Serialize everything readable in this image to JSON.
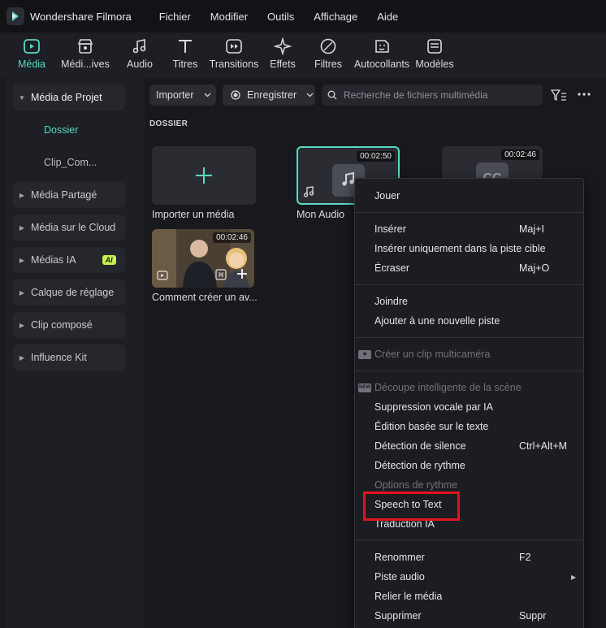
{
  "app": {
    "name": "Wondershare Filmora"
  },
  "menu": [
    "Fichier",
    "Modifier",
    "Outils",
    "Affichage",
    "Aide"
  ],
  "tabs": [
    {
      "label": "Média",
      "icon": "media-icon",
      "active": true
    },
    {
      "label": "Médi...ives",
      "icon": "store-icon",
      "active": false
    },
    {
      "label": "Audio",
      "icon": "music-note-icon",
      "active": false
    },
    {
      "label": "Titres",
      "icon": "text-icon",
      "active": false
    },
    {
      "label": "Transitions",
      "icon": "transition-icon",
      "active": false
    },
    {
      "label": "Effets",
      "icon": "sparkle-icon",
      "active": false
    },
    {
      "label": "Filtres",
      "icon": "filter-icon",
      "active": false
    },
    {
      "label": "Autocollants",
      "icon": "sticker-icon",
      "active": false
    },
    {
      "label": "Modèles",
      "icon": "template-icon",
      "active": false
    }
  ],
  "sidebar": {
    "items": [
      {
        "label": "Média de Projet",
        "open": true
      },
      {
        "label": "Média Partagé"
      },
      {
        "label": "Média sur le Cloud"
      },
      {
        "label": "Médias IA",
        "badge": "AI"
      },
      {
        "label": "Calque de réglage"
      },
      {
        "label": "Clip composé"
      },
      {
        "label": "Influence Kit"
      }
    ],
    "subitems": [
      {
        "label": "Dossier",
        "active": true
      },
      {
        "label": "Clip_Com..."
      }
    ]
  },
  "toolbar": {
    "import_label": "Importer",
    "record_label": "Enregistrer",
    "search_placeholder": "Recherche de fichiers multimédia"
  },
  "main": {
    "section_title": "DOSSIER",
    "cards": [
      {
        "label": "Importer un média",
        "duration": ""
      },
      {
        "label": "Mon Audio",
        "duration": "00:02:50"
      },
      {
        "label": "",
        "duration": "00:02:46"
      },
      {
        "label": "Comment créer un av...",
        "duration": "00:02:46"
      }
    ]
  },
  "context_menu": {
    "items": [
      {
        "label": "Jouer",
        "shortcut": ""
      },
      {
        "label": "Insérer",
        "shortcut": "Maj+I"
      },
      {
        "label": "Insérer uniquement dans la piste cible",
        "shortcut": ""
      },
      {
        "label": "Écraser",
        "shortcut": "Maj+O"
      },
      {
        "label": "Joindre",
        "shortcut": ""
      },
      {
        "label": "Ajouter à une nouvelle piste",
        "shortcut": ""
      },
      {
        "label": "Créer un clip multicaméra",
        "shortcut": "",
        "disabled": true
      },
      {
        "label": "Découpe intelligente de la scène",
        "shortcut": "",
        "disabled": true
      },
      {
        "label": "Suppression vocale par IA",
        "shortcut": ""
      },
      {
        "label": "Édition basée sur le texte",
        "shortcut": ""
      },
      {
        "label": "Détection de silence",
        "shortcut": "Ctrl+Alt+M"
      },
      {
        "label": "Détection de rythme",
        "shortcut": ""
      },
      {
        "label": "Options de rythme",
        "shortcut": "",
        "disabled": true
      },
      {
        "label": "Speech to Text",
        "shortcut": "",
        "highlighted": true
      },
      {
        "label": "Traduction IA",
        "shortcut": ""
      },
      {
        "label": "Renommer",
        "shortcut": "F2"
      },
      {
        "label": "Piste audio",
        "shortcut": "",
        "submenu": true
      },
      {
        "label": "Relier le média",
        "shortcut": ""
      },
      {
        "label": "Supprimer",
        "shortcut": "Suppr"
      }
    ],
    "highlight_color": "#e0141c"
  },
  "colors": {
    "accent": "#59d8c0",
    "background": "#1a1c21",
    "ai_badge": "#c6f24e"
  }
}
